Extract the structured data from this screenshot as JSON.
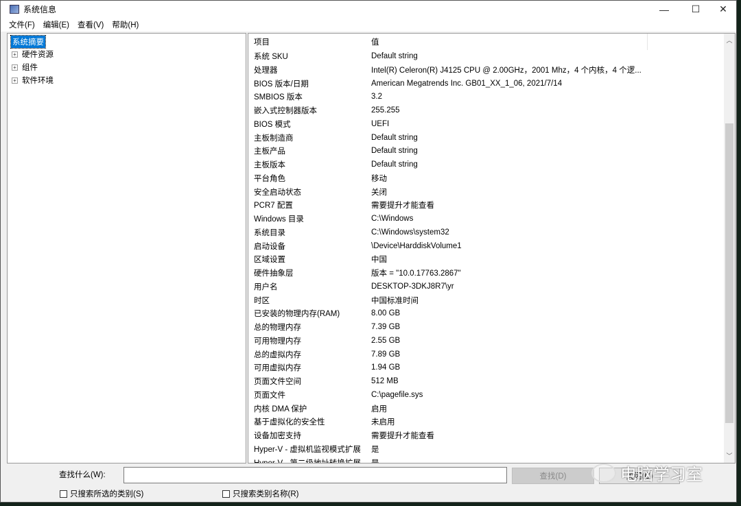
{
  "window": {
    "title": "系统信息",
    "minimize": "—",
    "maximize": "☐",
    "close": "✕"
  },
  "menu": [
    "文件(F)",
    "编辑(E)",
    "查看(V)",
    "帮助(H)"
  ],
  "tree": {
    "selected": "系统摘要",
    "nodes": [
      "硬件资源",
      "组件",
      "软件环境"
    ]
  },
  "table": {
    "headers": [
      "项目",
      "值"
    ],
    "rows": [
      [
        "系统 SKU",
        "Default string"
      ],
      [
        "处理器",
        "Intel(R) Celeron(R) J4125 CPU @ 2.00GHz，2001 Mhz，4 个内核，4 个逻..."
      ],
      [
        "BIOS 版本/日期",
        "American Megatrends Inc. GB01_XX_1_06, 2021/7/14"
      ],
      [
        "SMBIOS 版本",
        "3.2"
      ],
      [
        "嵌入式控制器版本",
        "255.255"
      ],
      [
        "BIOS 模式",
        "UEFI"
      ],
      [
        "主板制造商",
        "Default string"
      ],
      [
        "主板产品",
        "Default string"
      ],
      [
        "主板版本",
        "Default string"
      ],
      [
        "平台角色",
        "移动"
      ],
      [
        "安全启动状态",
        "关闭"
      ],
      [
        "PCR7 配置",
        "需要提升才能查看"
      ],
      [
        "Windows 目录",
        "C:\\Windows"
      ],
      [
        "系统目录",
        "C:\\Windows\\system32"
      ],
      [
        "启动设备",
        "\\Device\\HarddiskVolume1"
      ],
      [
        "区域设置",
        "中国"
      ],
      [
        "硬件抽象层",
        "版本 = \"10.0.17763.2867\""
      ],
      [
        "用户名",
        "DESKTOP-3DKJ8R7\\yr"
      ],
      [
        "时区",
        "中国标准时间"
      ],
      [
        "已安装的物理内存(RAM)",
        "8.00 GB"
      ],
      [
        "总的物理内存",
        "7.39 GB"
      ],
      [
        "可用物理内存",
        "2.55 GB"
      ],
      [
        "总的虚拟内存",
        "7.89 GB"
      ],
      [
        "可用虚拟内存",
        "1.94 GB"
      ],
      [
        "页面文件空间",
        "512 MB"
      ],
      [
        "页面文件",
        "C:\\pagefile.sys"
      ],
      [
        "内核 DMA 保护",
        "启用"
      ],
      [
        "基于虚拟化的安全性",
        "未启用"
      ],
      [
        "设备加密支持",
        "需要提升才能查看"
      ],
      [
        "Hyper-V - 虚拟机监视模式扩展",
        "是"
      ],
      [
        "Hyper-V - 第二级地址转换扩展",
        "是"
      ]
    ]
  },
  "search": {
    "label": "查找什么(W):",
    "value": "",
    "find_button": "查找(D)",
    "close_button": "关闭(C)",
    "check_selected": "只搜索所选的类别(S)",
    "check_names": "只搜索类别名称(R)"
  },
  "watermark": "电脑学习室"
}
